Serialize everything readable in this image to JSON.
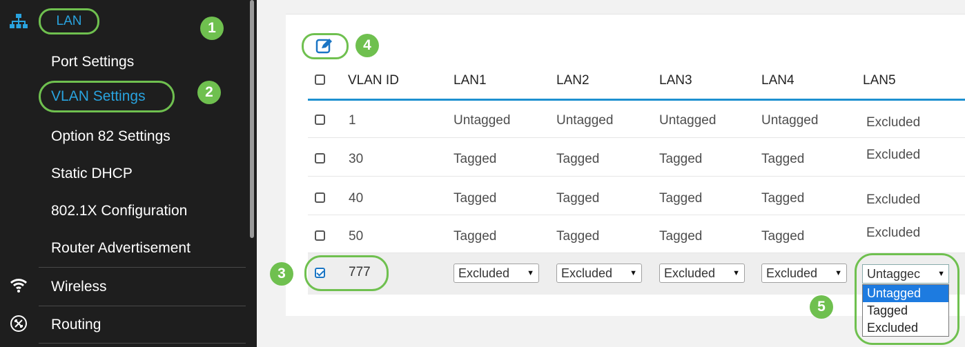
{
  "sidebar": {
    "section_title": "LAN",
    "items": [
      {
        "label": "Port Settings"
      },
      {
        "label": "VLAN Settings"
      },
      {
        "label": "Option 82 Settings"
      },
      {
        "label": "Static DHCP"
      },
      {
        "label": "802.1X Configuration"
      },
      {
        "label": "Router Advertisement"
      }
    ],
    "nav": [
      {
        "label": "Wireless",
        "icon": "wifi-icon"
      },
      {
        "label": "Routing",
        "icon": "routing-icon"
      }
    ]
  },
  "badges": [
    "1",
    "2",
    "3",
    "4",
    "5"
  ],
  "table": {
    "headers": [
      "VLAN ID",
      "LAN1",
      "LAN2",
      "LAN3",
      "LAN4",
      "LAN5"
    ],
    "rows": [
      {
        "vlan": "1",
        "lan1": "Untagged",
        "lan2": "Untagged",
        "lan3": "Untagged",
        "lan4": "Untagged",
        "lan5": "Excluded"
      },
      {
        "vlan": "30",
        "lan1": "Tagged",
        "lan2": "Tagged",
        "lan3": "Tagged",
        "lan4": "Tagged",
        "lan5": "Excluded"
      },
      {
        "vlan": "40",
        "lan1": "Tagged",
        "lan2": "Tagged",
        "lan3": "Tagged",
        "lan4": "Tagged",
        "lan5": "Excluded"
      },
      {
        "vlan": "50",
        "lan1": "Tagged",
        "lan2": "Tagged",
        "lan3": "Tagged",
        "lan4": "Tagged",
        "lan5": "Excluded"
      }
    ],
    "editing_row": {
      "vlan": "777",
      "lan1": "Excluded",
      "lan2": "Excluded",
      "lan3": "Excluded",
      "lan4": "Excluded",
      "lan5": "Untaggec"
    },
    "dropdown_options": [
      "Untagged",
      "Tagged",
      "Excluded"
    ],
    "dropdown_selected": "Untagged"
  },
  "colors": {
    "accent_green": "#6fc04f",
    "link_blue": "#29a3df",
    "header_rule": "#1e90d0",
    "option_highlight": "#1d7be0"
  }
}
